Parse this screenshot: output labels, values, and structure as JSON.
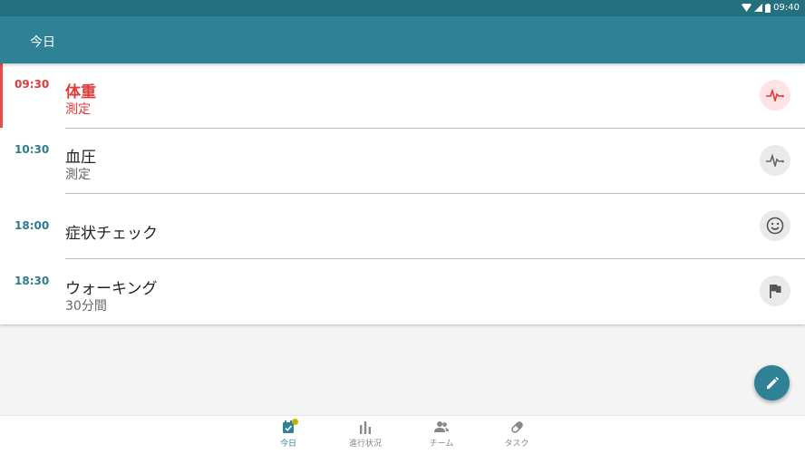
{
  "status_bar": {
    "time": "09:40"
  },
  "app_bar": {
    "title": "今日"
  },
  "schedule": [
    {
      "time": "09:30",
      "title": "体重",
      "subtitle": "測定",
      "icon": "heart-rate-icon",
      "active": true
    },
    {
      "time": "10:30",
      "title": "血圧",
      "subtitle": "測定",
      "icon": "heart-rate-icon",
      "active": false
    },
    {
      "time": "18:00",
      "title": "症状チェック",
      "subtitle": "",
      "icon": "smiley-icon",
      "active": false
    },
    {
      "time": "18:30",
      "title": "ウォーキング",
      "subtitle": "30分間",
      "icon": "flag-icon",
      "active": false
    }
  ],
  "fab": {
    "icon": "edit-pencil-icon"
  },
  "bottom_nav": [
    {
      "label": "今日",
      "icon": "calendar-check-icon",
      "active": true
    },
    {
      "label": "進行状況",
      "icon": "bar-chart-icon",
      "active": false
    },
    {
      "label": "チーム",
      "icon": "people-icon",
      "active": false
    },
    {
      "label": "タスク",
      "icon": "pill-icon",
      "active": false
    }
  ],
  "colors": {
    "primary": "#2f8196",
    "status_bar": "#25707f",
    "alert": "#e03a3a",
    "time_teal": "#2f7a8c"
  }
}
